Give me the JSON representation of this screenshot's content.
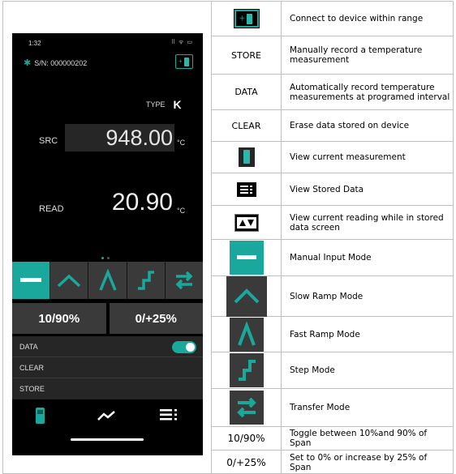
{
  "phone": {
    "time": "1:32",
    "status_icons": "⠿ ᯤ ▭",
    "serial": "S/N: 000000202",
    "type_label": "TYPE",
    "type_value": "K",
    "src_label": "SRC",
    "src_value": "948.00",
    "read_label": "READ",
    "read_value": "20.90",
    "unit": "°C",
    "span_low": "10/90%",
    "span_high": "0/+25%",
    "list": [
      "DATA",
      "CLEAR",
      "STORE"
    ],
    "data_toggle_on": true,
    "accent": "#19a89b"
  },
  "table": [
    {
      "key": "",
      "icon": "connect-icon",
      "desc": "Connect to device within range"
    },
    {
      "key": "STORE",
      "desc": "Manually record a temperature measurement"
    },
    {
      "key": "DATA",
      "desc": "Automatically record temperature measurements at programed interval"
    },
    {
      "key": "CLEAR",
      "desc": "Erase data stored on device"
    },
    {
      "key": "",
      "icon": "meter-icon",
      "desc": "View current measurement"
    },
    {
      "key": "",
      "icon": "stored-data-icon",
      "desc": "View Stored Data"
    },
    {
      "key": "",
      "icon": "updown-icon",
      "desc": "View current reading while in stored data screen"
    },
    {
      "key": "",
      "icon": "manual-input-icon",
      "desc": "Manual Input Mode"
    },
    {
      "key": "",
      "icon": "slow-ramp-icon",
      "desc": "Slow Ramp Mode"
    },
    {
      "key": "",
      "icon": "fast-ramp-icon",
      "desc": "Fast Ramp Mode"
    },
    {
      "key": "",
      "icon": "step-icon",
      "desc": "Step Mode"
    },
    {
      "key": "",
      "icon": "transfer-icon",
      "desc": "Transfer Mode"
    },
    {
      "key": "10/90%",
      "desc": "Toggle between 10%and 90% of Span"
    },
    {
      "key": "0/+25%",
      "desc": "Set to 0% or increase by 25% of Span"
    }
  ]
}
